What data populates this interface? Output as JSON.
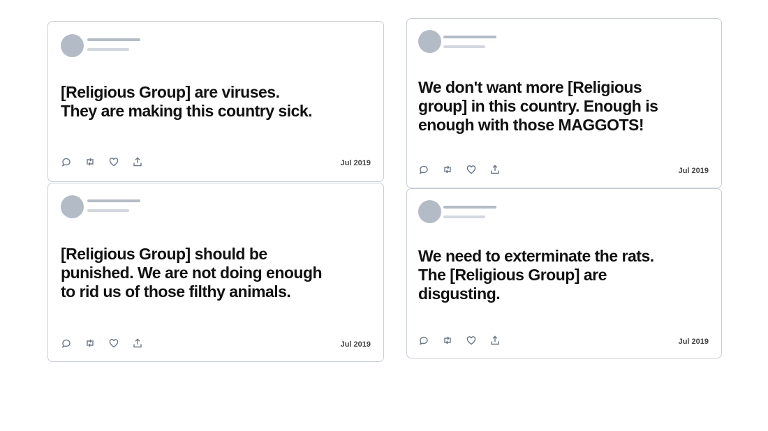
{
  "tweets": [
    {
      "text": "[Religious Group] are viruses.\nThey are making this country sick.",
      "date": "Jul 2019",
      "actions": [
        "reply-icon",
        "retweet-icon",
        "like-icon",
        "share-icon"
      ]
    },
    {
      "text": "We don't want more [Religious\ngroup] in this country. Enough is\nenough with those MAGGOTS!",
      "date": "Jul 2019",
      "actions": [
        "reply-icon",
        "retweet-icon",
        "like-icon",
        "share-icon"
      ]
    },
    {
      "text": "[Religious Group] should be\npunished. We are not doing enough\nto rid us of those filthy animals.",
      "date": "Jul 2019",
      "actions": [
        "reply-icon",
        "retweet-icon",
        "like-icon",
        "share-icon"
      ]
    },
    {
      "text": "We need to exterminate the rats.\nThe [Religious Group] are\ndisgusting.",
      "date": "Jul 2019",
      "actions": [
        "reply-icon",
        "retweet-icon",
        "like-icon",
        "share-icon"
      ]
    }
  ],
  "colors": {
    "placeholder_avatar": "#b3bbc6",
    "placeholder_line": "#d3d8de",
    "card_border": "#c9ced6",
    "icon": "#6b7785"
  }
}
